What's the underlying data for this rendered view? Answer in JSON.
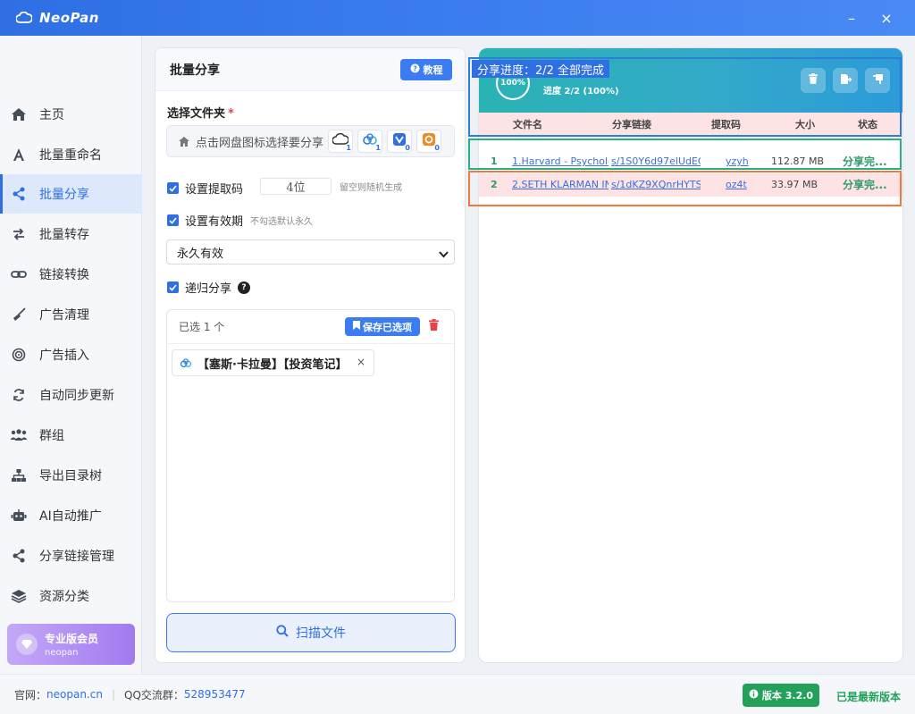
{
  "app": {
    "title": "NeoPan",
    "min_symbol": "–",
    "close_symbol": "×"
  },
  "sidebar": {
    "items": [
      {
        "label": "主页",
        "icon": "home-icon"
      },
      {
        "label": "批量重命名",
        "icon": "font-icon"
      },
      {
        "label": "批量分享",
        "icon": "share-icon"
      },
      {
        "label": "批量转存",
        "icon": "transfer-icon"
      },
      {
        "label": "链接转换",
        "icon": "link-icon"
      },
      {
        "label": "广告清理",
        "icon": "broom-icon"
      },
      {
        "label": "广告插入",
        "icon": "target-icon"
      },
      {
        "label": "自动同步更新",
        "icon": "sync-icon"
      },
      {
        "label": "群组",
        "icon": "users-icon"
      },
      {
        "label": "导出目录树",
        "icon": "sitemap-icon"
      },
      {
        "label": "AI自动推广",
        "icon": "robot-icon"
      },
      {
        "label": "分享链接管理",
        "icon": "share-nodes-icon"
      },
      {
        "label": "资源分类",
        "icon": "layers-icon"
      }
    ],
    "active_index": 2,
    "pro": {
      "title": "专业版会员",
      "subtitle": "neopan"
    }
  },
  "share_panel": {
    "title": "批量分享",
    "tutorial_label": "教程",
    "folder_label": "选择文件夹",
    "required_mark": "*",
    "folder_placeholder": "点击网盘图标选择要分享",
    "pan_badges": [
      "1",
      "1",
      "0",
      "0"
    ],
    "set_code_label": "设置提取码",
    "code_value": "4位",
    "code_hint": "留空则随机生成",
    "set_expiry_label": "设置有效期",
    "expiry_hint": "不勾选默认永久",
    "expiry_selected": "永久有效",
    "recursive_label": "递归分享",
    "help_mark": "?",
    "selected_count": "已选 1 个",
    "save_label": "保存已选项",
    "selected_items": [
      {
        "name": "【塞斯·卡拉曼】【投资笔记】"
      }
    ],
    "chip_remove": "×",
    "scan_label": "扫描文件"
  },
  "progress": {
    "title": "分享进度：2/2 全部完成",
    "percent": "100%",
    "detail": "进度 2/2 (100%)",
    "columns": [
      "文件名",
      "分享链接",
      "提取码",
      "大小",
      "状态"
    ],
    "rows": [
      {
        "index": "1",
        "name": "1.Harvard - Psycholc",
        "link": "s/1S0Y6d97elUdEQjt",
        "code": "yzyh",
        "size": "112.87 MB",
        "status": "分享完..."
      },
      {
        "index": "2",
        "name": "2.SETH KLARMAN IN",
        "link": "s/1dKZ9XQnrHYTSc",
        "code": "oz4t",
        "size": "33.97 MB",
        "status": "分享完..."
      }
    ]
  },
  "footer": {
    "site_label": "官网：",
    "site_value": "neopan.cn",
    "qq_label": "QQ交流群：",
    "qq_value": "528953477",
    "version_label": "版本 3.2.0",
    "latest_label": "已是最新版本"
  },
  "colors": {
    "accent": "#2f6fe4",
    "success": "#23a15a",
    "danger": "#e54545",
    "pro": "#a27af0"
  }
}
